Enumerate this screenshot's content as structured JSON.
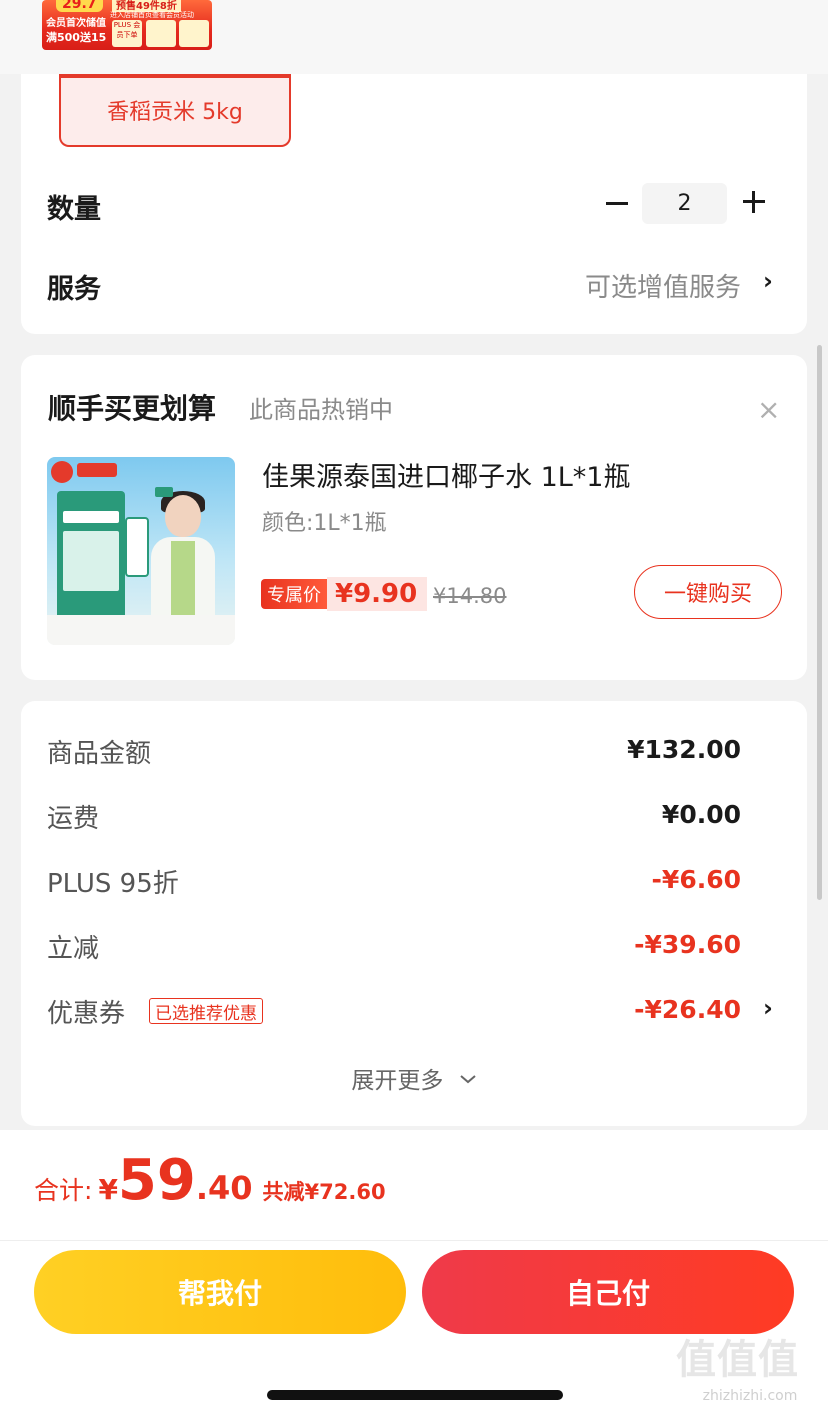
{
  "promo_banner": {
    "price": "29.7",
    "tag": "预售49件8折",
    "line1": "会员首次储值",
    "line2": "满500送15",
    "sub": "进入店铺首页查看会员活动",
    "mini1": "PLUS 会员下单",
    "mini2": "",
    "mini3": ""
  },
  "selected_spec": "香稻贡米 5kg",
  "quantity": {
    "label": "数量",
    "value": "2"
  },
  "service": {
    "label": "服务",
    "value": "可选增值服务"
  },
  "addon": {
    "title": "顺手买更划算",
    "subtitle": "此商品热销中",
    "close": "×",
    "product_name": "佳果源泰国进口椰子水 1L*1瓶",
    "product_spec": "颜色:1L*1瓶",
    "price_label": "专属价",
    "price": "¥9.90",
    "original_price": "¥14.80",
    "buy_button": "一键购买"
  },
  "fees": [
    {
      "label": "商品金额",
      "value": "¥132.00",
      "red": false
    },
    {
      "label": "运费",
      "value": "¥0.00",
      "red": false
    },
    {
      "label": "PLUS 95折",
      "value": "-¥6.60",
      "red": true
    },
    {
      "label": "立减",
      "value": "-¥39.60",
      "red": true
    },
    {
      "label": "优惠券",
      "value": "-¥26.40",
      "red": true
    }
  ],
  "coupon_badge": "已选推荐优惠",
  "expand_more": "展开更多",
  "total": {
    "label": "合计:",
    "currency": "¥",
    "integer": "59",
    "decimal": ".40",
    "saved": "共减¥72.60"
  },
  "buttons": {
    "help_pay": "帮我付",
    "self_pay": "自己付"
  },
  "chevron": "›",
  "watermark": {
    "logo": "值值值",
    "site": "zhizhizhi.com"
  },
  "colors": {
    "accent_red": "#e8331f",
    "yellow_button": "#ffc414",
    "red_button": "#f73436"
  }
}
